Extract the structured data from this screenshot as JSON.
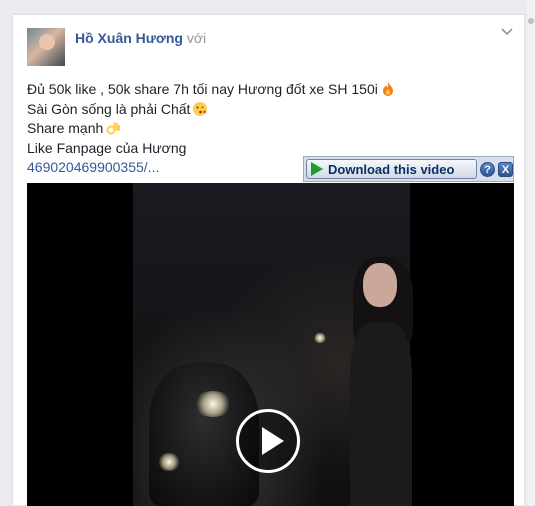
{
  "post": {
    "author": "Hồ Xuân Hương",
    "with_text": "với",
    "lines": [
      "Đủ 50k like , 50k share 7h tối nay Hương đốt xe SH 150i",
      "Sài Gòn sống là phải Chất",
      "Share mạnh",
      "Like Fanpage của Hương"
    ],
    "link": "469020469900355/..."
  },
  "download_toolbar": {
    "button_label": "Download this video",
    "help_label": "?",
    "close_label": "X"
  },
  "icons": {
    "fire": "fire-emoji",
    "kiss": "kissing-face-emoji",
    "ok": "ok-hand-emoji",
    "play": "play-icon",
    "chevron": "chevron-down-icon"
  },
  "colors": {
    "author": "#365899",
    "link": "#365899",
    "text": "#1d2129",
    "download_arrow": "#1f9e2c"
  }
}
